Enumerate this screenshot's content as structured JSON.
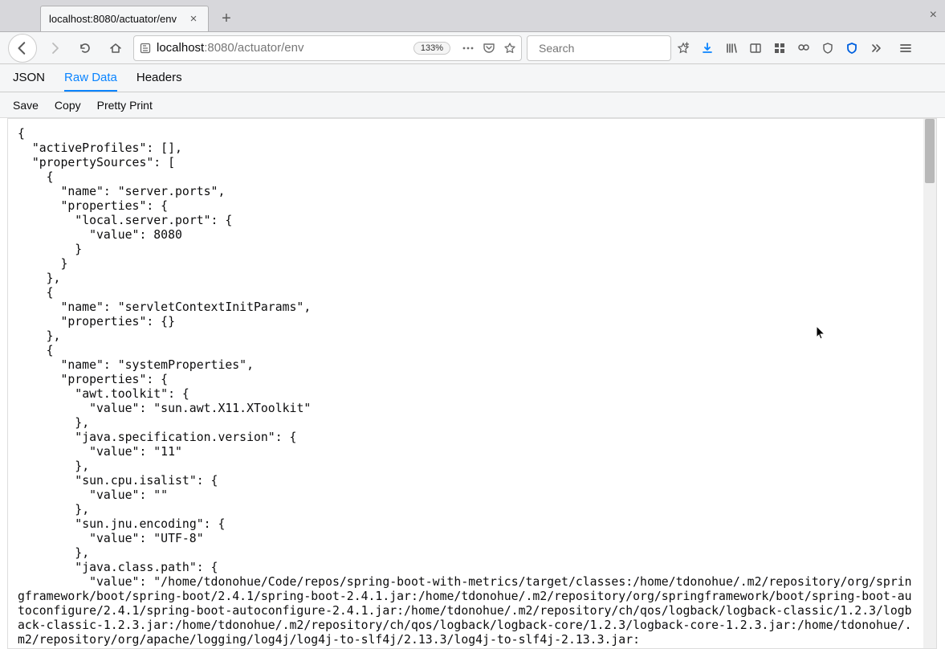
{
  "tab": {
    "title": "localhost:8080/actuator/env"
  },
  "url": {
    "scheme_host": "localhost",
    "rest": ":8080/actuator/env",
    "zoom": "133%"
  },
  "search": {
    "placeholder": "Search"
  },
  "viewer": {
    "tabs": {
      "json": "JSON",
      "raw": "Raw Data",
      "headers": "Headers"
    },
    "actions": {
      "save": "Save",
      "copy": "Copy",
      "pretty": "Pretty Print"
    }
  },
  "json_text": "{\n  \"activeProfiles\": [],\n  \"propertySources\": [\n    {\n      \"name\": \"server.ports\",\n      \"properties\": {\n        \"local.server.port\": {\n          \"value\": 8080\n        }\n      }\n    },\n    {\n      \"name\": \"servletContextInitParams\",\n      \"properties\": {}\n    },\n    {\n      \"name\": \"systemProperties\",\n      \"properties\": {\n        \"awt.toolkit\": {\n          \"value\": \"sun.awt.X11.XToolkit\"\n        },\n        \"java.specification.version\": {\n          \"value\": \"11\"\n        },\n        \"sun.cpu.isalist\": {\n          \"value\": \"\"\n        },\n        \"sun.jnu.encoding\": {\n          \"value\": \"UTF-8\"\n        },\n        \"java.class.path\": {\n          \"value\": \"/home/tdonohue/Code/repos/spring-boot-with-metrics/target/classes:/home/tdonohue/.m2/repository/org/springframework/boot/spring-boot/2.4.1/spring-boot-2.4.1.jar:/home/tdonohue/.m2/repository/org/springframework/boot/spring-boot-autoconfigure/2.4.1/spring-boot-autoconfigure-2.4.1.jar:/home/tdonohue/.m2/repository/ch/qos/logback/logback-classic/1.2.3/logback-classic-1.2.3.jar:/home/tdonohue/.m2/repository/ch/qos/logback/logback-core/1.2.3/logback-core-1.2.3.jar:/home/tdonohue/.m2/repository/org/apache/logging/log4j/log4j-to-slf4j/2.13.3/log4j-to-slf4j-2.13.3.jar:"
}
